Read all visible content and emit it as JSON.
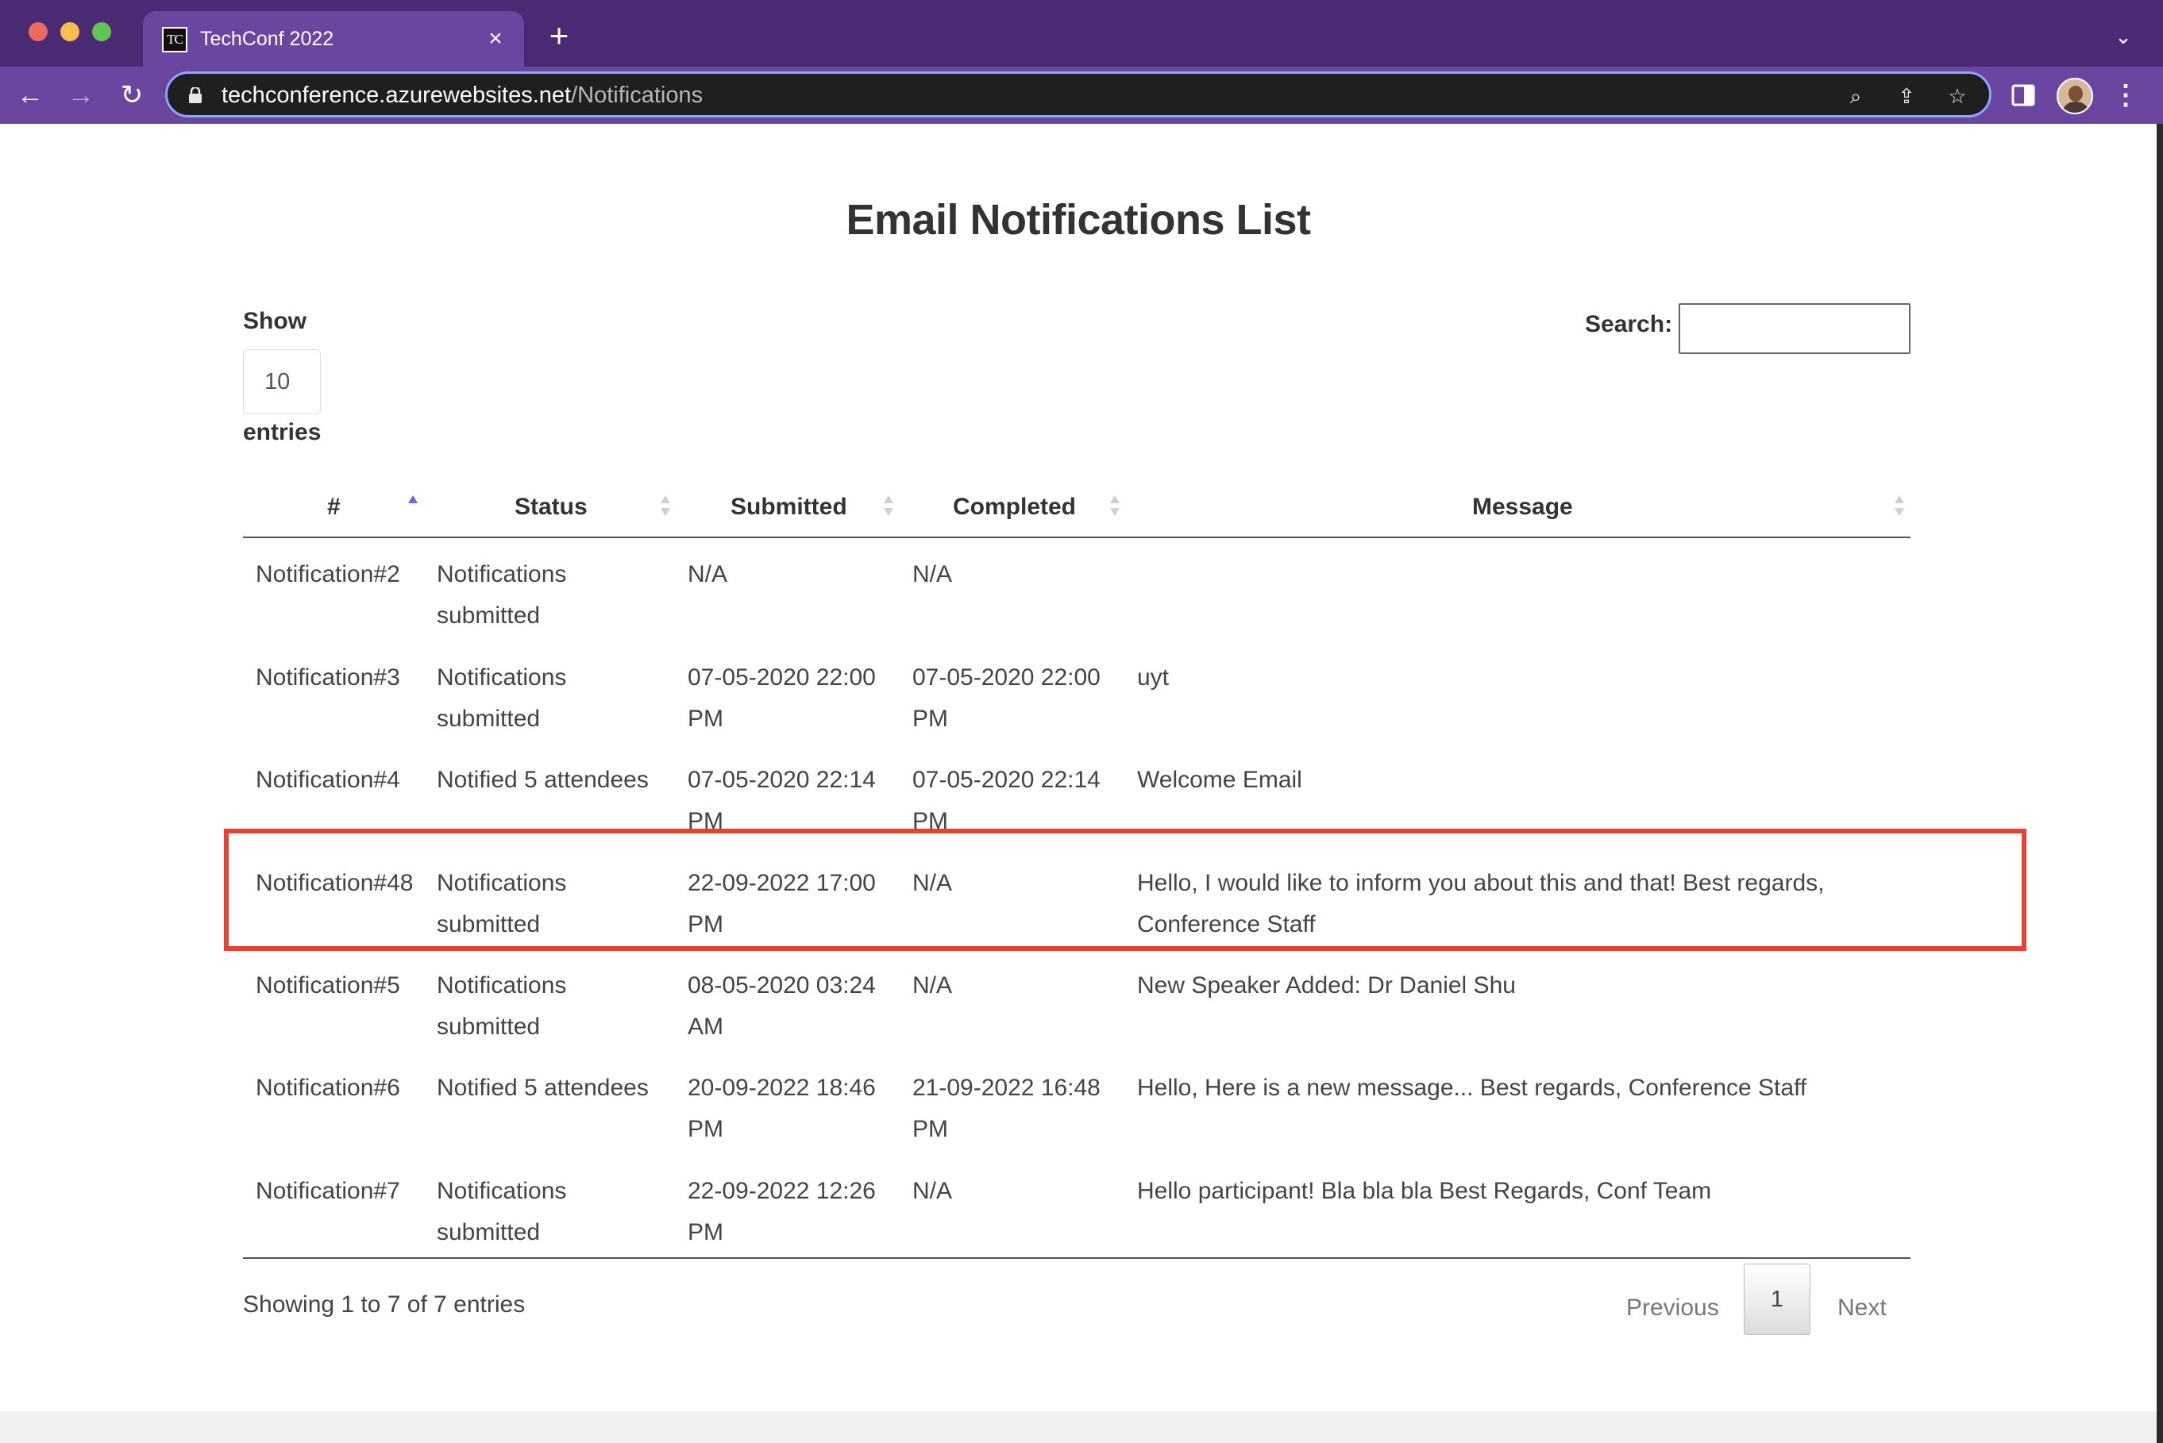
{
  "browser": {
    "tab_title": "TechConf 2022",
    "favicon_text": "TC",
    "url_host": "techconference.azurewebsites.net",
    "url_path": "/Notifications",
    "accent_color": "#6a46a0",
    "titlebar_color": "#4b2a74"
  },
  "icons": {
    "close": "×",
    "new_tab": "+",
    "tab_list": "⌄",
    "back": "←",
    "forward": "→",
    "reload": "↻",
    "zoom": "⌕",
    "share": "⇪",
    "star": "☆",
    "menu": "⋮"
  },
  "page": {
    "title": "Email Notifications List",
    "show_label": "Show",
    "page_length": "10",
    "entries_label": "entries",
    "search_label": "Search:",
    "search_value": ""
  },
  "table": {
    "columns": [
      "#",
      "Status",
      "Submitted",
      "Completed",
      "Message"
    ],
    "sorted_column": "#",
    "sort_direction": "ascending",
    "rows": [
      {
        "id": "Notification#2",
        "status": "Notifications submitted",
        "submitted": "N/A",
        "completed": "N/A",
        "message": ""
      },
      {
        "id": "Notification#3",
        "status": "Notifications submitted",
        "submitted": "07-05-2020 22:00 PM",
        "completed": "07-05-2020 22:00 PM",
        "message": "uyt"
      },
      {
        "id": "Notification#4",
        "status": "Notified 5 attendees",
        "submitted": "07-05-2020 22:14 PM",
        "completed": "07-05-2020 22:14 PM",
        "message": "Welcome Email"
      },
      {
        "id": "Notification#48",
        "status": "Notifications submitted",
        "submitted": "22-09-2022 17:00 PM",
        "completed": "N/A",
        "message": "Hello, I would like to inform you about this and that! Best regards, Conference Staff",
        "highlighted": true
      },
      {
        "id": "Notification#5",
        "status": "Notifications submitted",
        "submitted": "08-05-2020 03:24 AM",
        "completed": "N/A",
        "message": "New Speaker Added: Dr Daniel Shu"
      },
      {
        "id": "Notification#6",
        "status": "Notified 5 attendees",
        "submitted": "20-09-2022 18:46 PM",
        "completed": "21-09-2022 16:48 PM",
        "message": "Hello, Here is a new message... Best regards, Conference Staff"
      },
      {
        "id": "Notification#7",
        "status": "Notifications submitted",
        "submitted": "22-09-2022 12:26 PM",
        "completed": "N/A",
        "message": "Hello participant! Bla bla bla Best Regards, Conf Team"
      }
    ],
    "highlight_color": "#e34234"
  },
  "footer": {
    "info": "Showing 1 to 7 of 7 entries",
    "previous_label": "Previous",
    "current_page": "1",
    "next_label": "Next"
  }
}
